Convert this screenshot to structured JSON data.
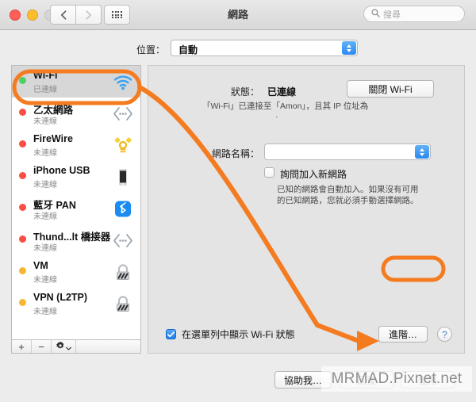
{
  "window": {
    "title": "網路",
    "search_placeholder": "搜尋"
  },
  "toolbar": {
    "back_icon": "chevron-left-icon",
    "forward_icon": "chevron-right-icon",
    "grid_icon": "show-all-grid-icon",
    "search_icon": "search-icon"
  },
  "location": {
    "label": "位置：",
    "value": "自動"
  },
  "sidebar": {
    "items": [
      {
        "name": "Wi-Fi",
        "status": "已連線",
        "dot": "green",
        "icon": "wifi-icon",
        "selected": true
      },
      {
        "name": "乙太網路",
        "status": "未連線",
        "dot": "red",
        "icon": "ethernet-icon",
        "selected": false
      },
      {
        "name": "FireWire",
        "status": "未連線",
        "dot": "red",
        "icon": "firewire-icon",
        "selected": false
      },
      {
        "name": "iPhone USB",
        "status": "未連線",
        "dot": "red",
        "icon": "iphone-icon",
        "selected": false
      },
      {
        "name": "藍牙 PAN",
        "status": "未連線",
        "dot": "red",
        "icon": "bluetooth-icon",
        "selected": false
      },
      {
        "name": "Thund...lt 橋接器",
        "status": "未連線",
        "dot": "red",
        "icon": "ethernet-icon",
        "selected": false
      },
      {
        "name": "VM",
        "status": "未連線",
        "dot": "amber",
        "icon": "lock-icon",
        "selected": false
      },
      {
        "name": "VPN (L2TP)",
        "status": "未連線",
        "dot": "amber",
        "icon": "lock-icon",
        "selected": false
      }
    ],
    "footer": {
      "add_label": "+",
      "remove_label": "−",
      "gear_icon": "gear-icon",
      "gear_chevron_icon": "chevron-down-icon"
    }
  },
  "main": {
    "status_label": "狀態：",
    "status_value": "已連線",
    "turn_off_button": "關閉 Wi-Fi",
    "status_detail": "「Wi-Fi」已連接至「Amon」，且其 IP 位址為",
    "status_detail_redacted": "·",
    "network_name_label": "網路名稱：",
    "network_name_value": "",
    "ask_join_checkbox": {
      "label": "詢問加入新網路",
      "checked": false
    },
    "ask_join_description": "已知的網路會自動加入。如果沒有可用的已知網路，您就必須手動選擇網路。",
    "show_status_checkbox": {
      "label": "在選單列中顯示 Wi-Fi 狀態",
      "checked": true
    },
    "advanced_button": "進階…",
    "help_button": "?"
  },
  "footer": {
    "assist_button": "協助我…",
    "revert_button": "回復",
    "apply_button": "套用"
  },
  "annotation": {
    "accent_color": "#F47B20",
    "highlight_target_sidebar": "Wi-Fi",
    "highlight_target_button": "進階…"
  },
  "watermark": {
    "text": "MRMAD.Pixnet.net"
  }
}
